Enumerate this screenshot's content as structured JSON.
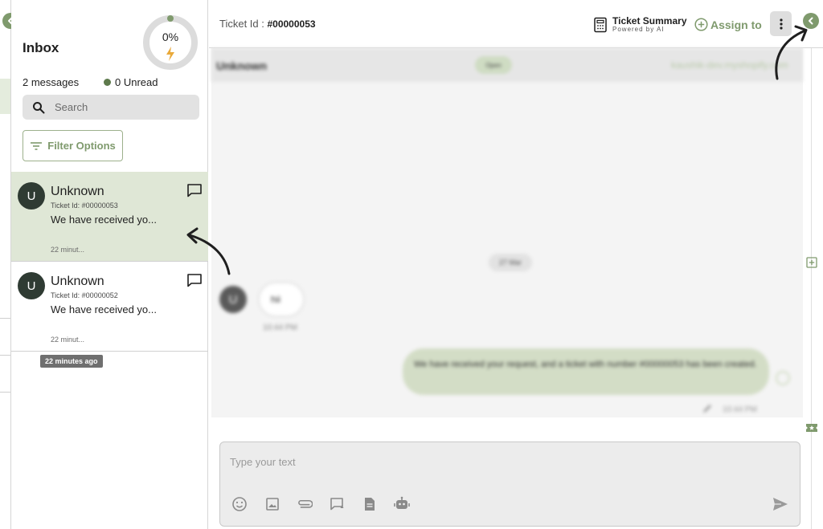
{
  "inbox": {
    "title": "Inbox",
    "progress_label": "0%",
    "message_count": "2 messages",
    "unread": "0 Unread",
    "search_placeholder": "Search",
    "filter_label": "Filter Options",
    "tickets": [
      {
        "avatar": "U",
        "name": "Unknown",
        "ticket_id": "Ticket Id: #00000053",
        "preview": "We have received yo...",
        "time": "22 minut..."
      },
      {
        "avatar": "U",
        "name": "Unknown",
        "ticket_id": "Ticket Id: #00000052",
        "preview": "We have received yo...",
        "time": "22 minut..."
      }
    ],
    "tooltip": "22 minutes ago"
  },
  "header": {
    "ticket_id_label": "Ticket Id : ",
    "ticket_id_value": "#00000053",
    "summary_title": "Ticket Summary",
    "summary_sub": "Powered by AI",
    "assign_label": "Assign to"
  },
  "chat": {
    "contact_name": "Unknown",
    "status": "Open",
    "shop": "kaushik-dev.myshopify.com",
    "date": "27 Mar",
    "incoming": {
      "avatar": "U",
      "text": "hii",
      "time": "10:44 PM"
    },
    "outgoing": {
      "text": "We have received your request, and a ticket with number #00000053 has been created.",
      "time": "10:44 PM"
    }
  },
  "composer": {
    "placeholder": "Type your text"
  },
  "colors": {
    "accent": "#7f9a6d",
    "selected_row": "#dfe7d6",
    "avatar": "#2f3b33"
  }
}
